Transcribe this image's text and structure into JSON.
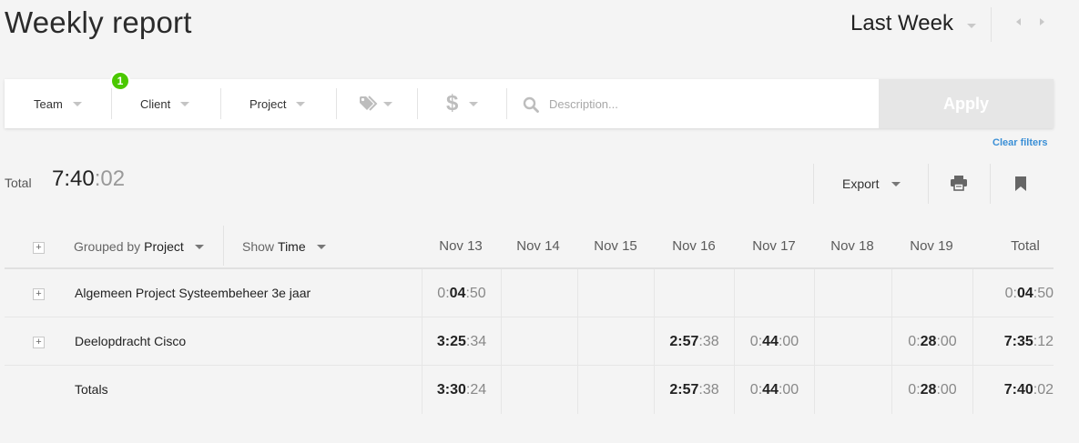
{
  "header": {
    "title": "Weekly report",
    "period": "Last Week"
  },
  "filters": {
    "team": "Team",
    "team_badge": "1",
    "client": "Client",
    "project": "Project",
    "description_placeholder": "Description...",
    "apply": "Apply",
    "clear": "Clear filters"
  },
  "summary": {
    "total_label": "Total",
    "total_hm": "7:40",
    "total_sec": ":02"
  },
  "toolbar": {
    "export": "Export"
  },
  "table": {
    "group_prefix": "Grouped by",
    "group_value": "Project",
    "show_prefix": "Show",
    "show_value": "Time",
    "columns": [
      "Nov 13",
      "Nov 14",
      "Nov 15",
      "Nov 16",
      "Nov 17",
      "Nov 18",
      "Nov 19",
      "Total"
    ],
    "rows": [
      {
        "label": "Algemeen Project Systeembeheer 3e jaar",
        "cells": [
          [
            "0:",
            "04",
            ":50"
          ],
          null,
          null,
          null,
          null,
          null,
          null,
          [
            "0:",
            "04",
            ":50"
          ]
        ]
      },
      {
        "label": "Deelopdracht Cisco",
        "cells": [
          [
            "3:",
            "25",
            ":34"
          ],
          null,
          null,
          [
            "2:",
            "57",
            ":38"
          ],
          [
            "0:",
            "44",
            ":00"
          ],
          null,
          [
            "0:",
            "28",
            ":00"
          ],
          [
            "7:",
            "35",
            ":12"
          ]
        ]
      },
      {
        "label": "Totals",
        "cells": [
          [
            "3:",
            "30",
            ":24"
          ],
          null,
          null,
          [
            "2:",
            "57",
            ":38"
          ],
          [
            "0:",
            "44",
            ":00"
          ],
          null,
          [
            "0:",
            "28",
            ":00"
          ],
          [
            "7:",
            "40",
            ":02"
          ]
        ]
      }
    ]
  },
  "colors": {
    "accent_green": "#4bc800",
    "link_blue": "#3a8fd6",
    "apply_bg": "#e6e6e6"
  }
}
